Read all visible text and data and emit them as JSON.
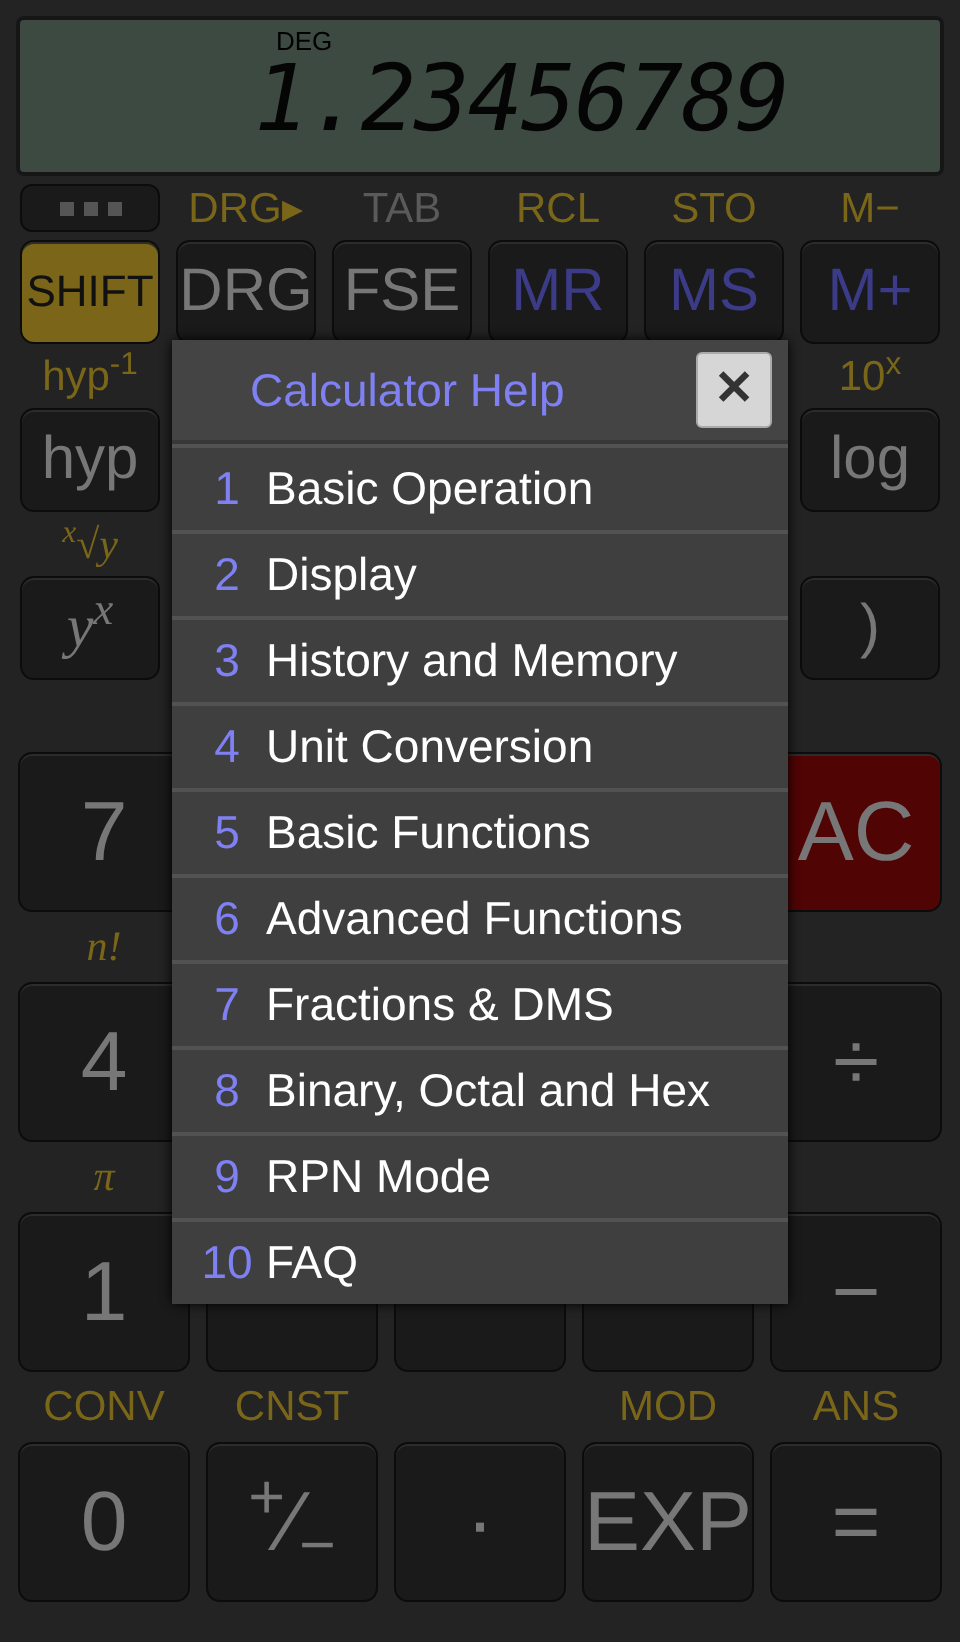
{
  "display": {
    "mode": "DEG",
    "value": "1.23456789"
  },
  "function_rows": [
    {
      "kind": "labels",
      "cells": [
        {
          "kind": "more"
        },
        {
          "text": "DRG▸",
          "disabled": false
        },
        {
          "text": "TAB",
          "disabled": true
        },
        {
          "text": "RCL",
          "disabled": false
        },
        {
          "text": "STO",
          "disabled": false
        },
        {
          "text": "M−",
          "disabled": false
        }
      ]
    },
    {
      "kind": "keys",
      "cells": [
        {
          "text": "SHIFT",
          "kind": "shift"
        },
        {
          "text": "DRG",
          "kind": "plain"
        },
        {
          "text": "FSE",
          "kind": "plain"
        },
        {
          "text": "MR",
          "kind": "memory"
        },
        {
          "text": "MS",
          "kind": "memory"
        },
        {
          "text": "M+",
          "kind": "memory"
        }
      ]
    },
    {
      "kind": "labels",
      "cells": [
        {
          "text": "hyp$^{-1}$",
          "disabled": false
        },
        null,
        null,
        null,
        null,
        {
          "text": "10$^{x}$",
          "disabled": false
        }
      ]
    },
    {
      "kind": "keys",
      "cells": [
        {
          "text": "hyp",
          "kind": "plain"
        },
        null,
        null,
        null,
        null,
        {
          "text": "log",
          "kind": "plain"
        }
      ]
    },
    {
      "kind": "labels",
      "cells": [
        {
          "text": "$^{x}$√y",
          "disabled": false,
          "kind": "math"
        },
        null,
        null,
        null,
        null,
        null
      ]
    },
    {
      "kind": "keys",
      "cells": [
        {
          "text": "y$^{x}$",
          "kind": "math"
        },
        null,
        null,
        null,
        null,
        {
          "text": ")",
          "kind": "plain"
        }
      ]
    }
  ],
  "number_rows": [
    {
      "kind": "keys",
      "cells": [
        {
          "text": "7",
          "kind": "plain"
        },
        null,
        null,
        null,
        {
          "text": "AC",
          "kind": "clear"
        }
      ]
    },
    {
      "kind": "labels",
      "cells": [
        {
          "text": "n!",
          "disabled": false,
          "kind": "math"
        },
        null,
        null,
        null,
        null
      ]
    },
    {
      "kind": "keys",
      "cells": [
        {
          "text": "4",
          "kind": "plain"
        },
        null,
        null,
        null,
        {
          "text": "÷",
          "kind": "plain"
        }
      ]
    },
    {
      "kind": "labels",
      "cells": [
        {
          "text": "π",
          "disabled": false,
          "kind": "math"
        },
        null,
        null,
        null,
        null
      ]
    },
    {
      "kind": "keys",
      "cells": [
        {
          "text": "1",
          "kind": "plain"
        },
        {
          "kind": "plain"
        },
        {
          "kind": "plain"
        },
        {
          "kind": "plain"
        },
        {
          "text": "−",
          "kind": "plain"
        }
      ]
    },
    {
      "kind": "labels",
      "cells": [
        {
          "text": "CONV",
          "disabled": false
        },
        {
          "text": "CNST",
          "disabled": false
        },
        null,
        {
          "text": "MOD",
          "disabled": false
        },
        {
          "text": "ANS",
          "disabled": false
        }
      ]
    },
    {
      "kind": "keys",
      "cells": [
        {
          "text": "0",
          "kind": "plain"
        },
        {
          "text": "$^{+}$∕$_{−}$",
          "kind": "plain"
        },
        {
          "text": "·",
          "kind": "plain"
        },
        {
          "text": "EXP",
          "kind": "plain"
        },
        {
          "text": "=",
          "kind": "plain"
        }
      ]
    }
  ],
  "dialog": {
    "title": "Calculator Help",
    "close": "✕",
    "items": [
      {
        "number": "1",
        "label": "Basic Operation"
      },
      {
        "number": "2",
        "label": "Display"
      },
      {
        "number": "3",
        "label": "History and Memory"
      },
      {
        "number": "4",
        "label": "Unit Conversion"
      },
      {
        "number": "5",
        "label": "Basic Functions"
      },
      {
        "number": "6",
        "label": "Advanced Functions"
      },
      {
        "number": "7",
        "label": "Fractions & DMS"
      },
      {
        "number": "8",
        "label": "Binary, Octal and Hex"
      },
      {
        "number": "9",
        "label": "RPN Mode"
      },
      {
        "number": "10",
        "label": "FAQ"
      }
    ]
  }
}
